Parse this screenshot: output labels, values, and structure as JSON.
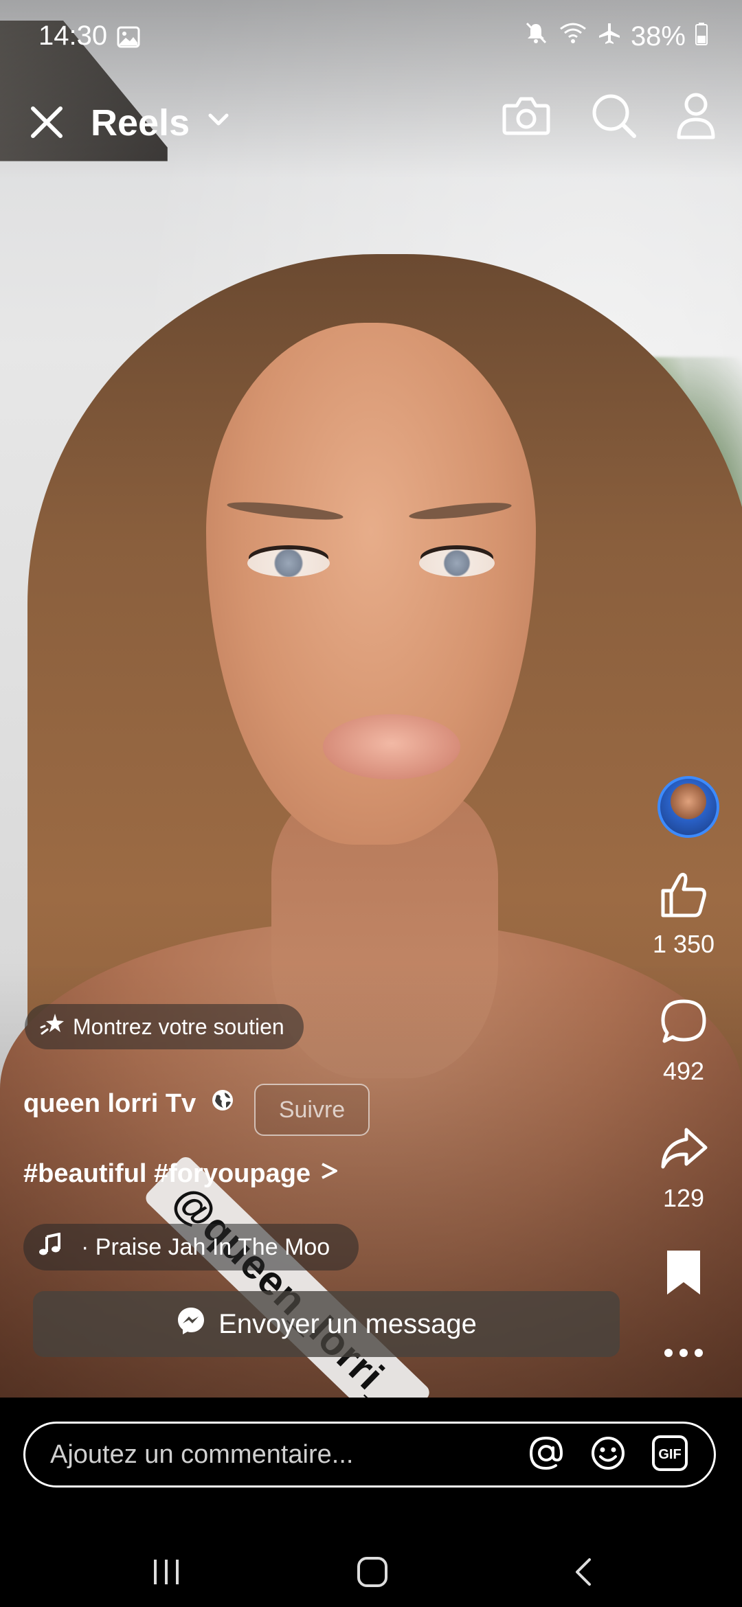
{
  "status_bar": {
    "time": "14:30",
    "battery": "38%"
  },
  "top_nav": {
    "title": "Reels"
  },
  "video": {
    "watermark_text": "@queen_lorri_"
  },
  "side_actions": {
    "likes": "1 350",
    "comments": "492",
    "shares": "129"
  },
  "post": {
    "support_label": "Montrez votre soutien",
    "author": "queen lorri Tv",
    "follow_label": "Suivre",
    "caption": "#beautiful #foryoupage",
    "music_track": "· Praise Jah In The Moo",
    "message_button": "Envoyer un message"
  },
  "comment_bar": {
    "placeholder": "Ajoutez un commentaire..."
  },
  "colors": {
    "accent_blue": "#3d8bff",
    "background": "#000000",
    "text": "#ffffff"
  }
}
